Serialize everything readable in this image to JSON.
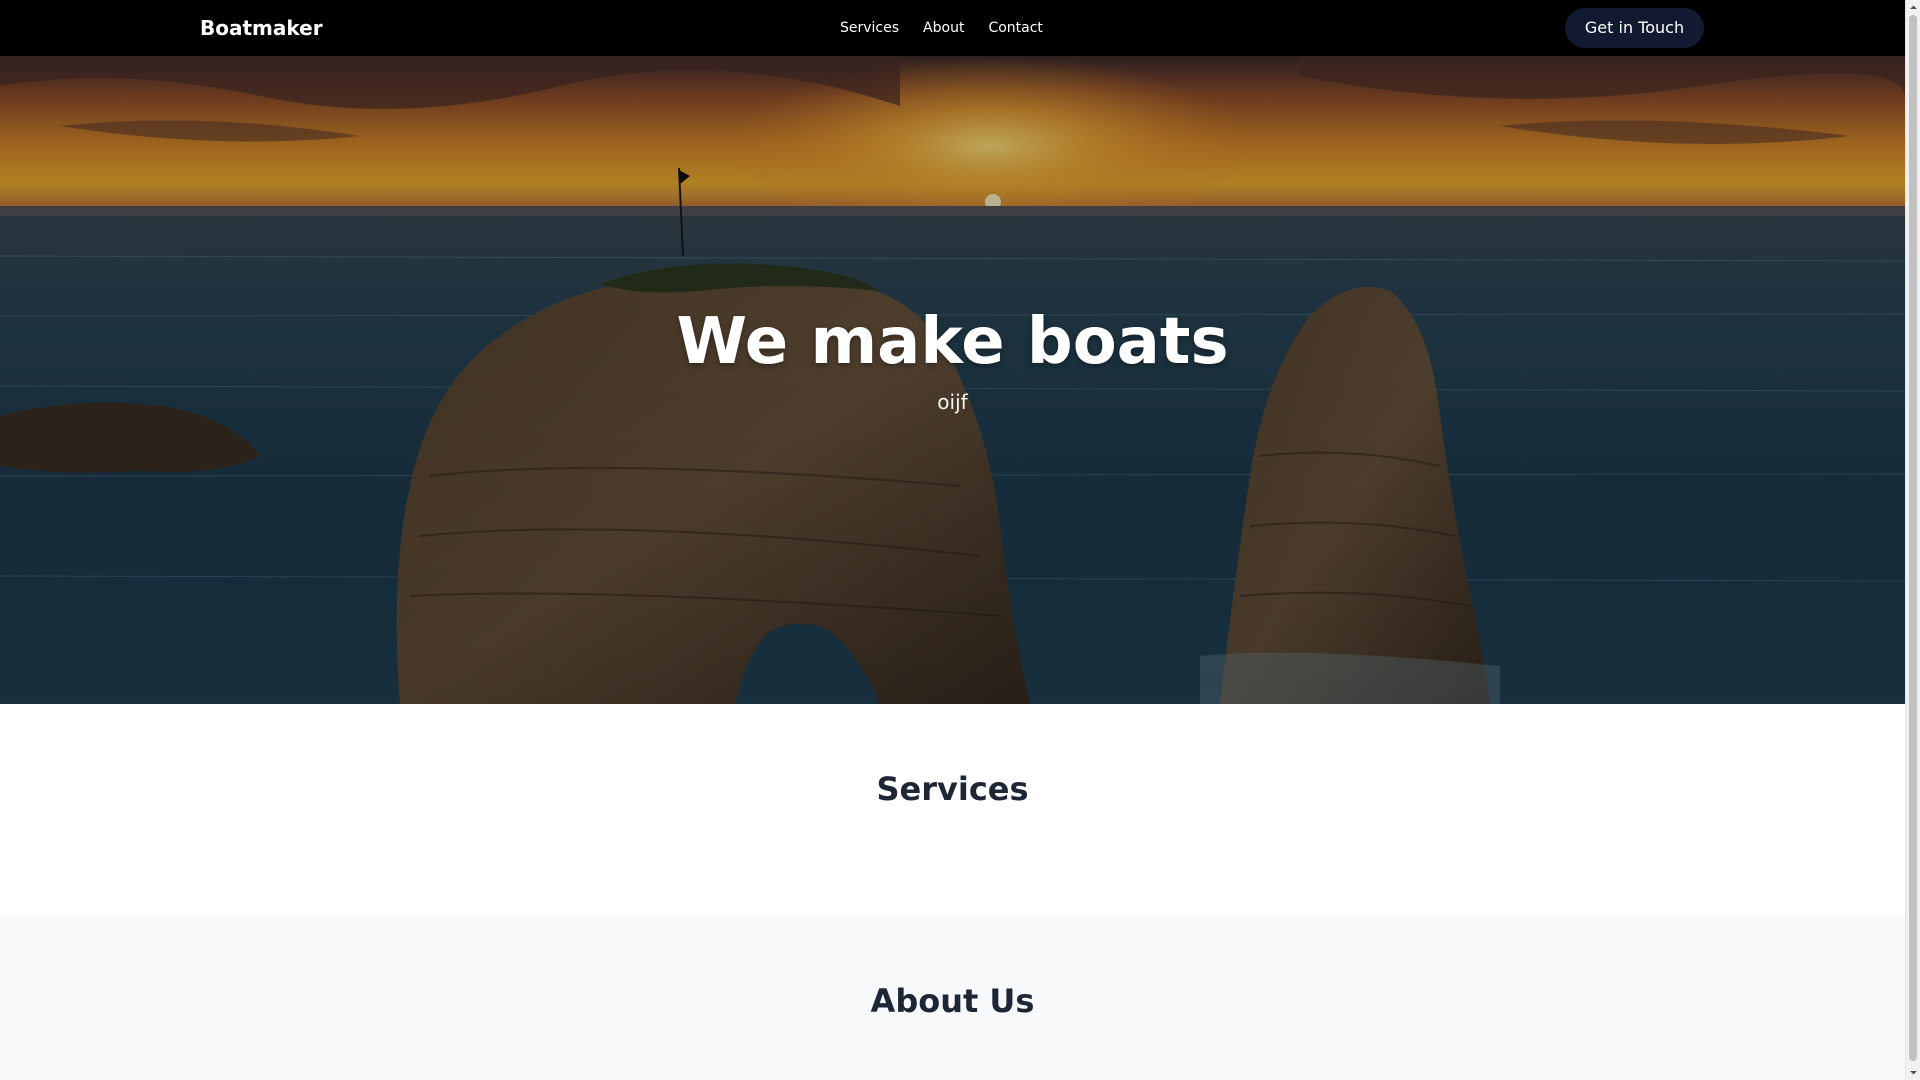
{
  "navbar": {
    "brand": "Boatmaker",
    "links": [
      {
        "label": "Services"
      },
      {
        "label": "About"
      },
      {
        "label": "Contact"
      }
    ],
    "cta_label": "Get in Touch",
    "background_color": "#000000",
    "cta_color": "#111a30"
  },
  "hero": {
    "title": "We make boats",
    "subtitle": "oijf",
    "background_image": "sunset-sea-rocks-photo"
  },
  "services": {
    "title": "Services"
  },
  "about": {
    "title": "About Us"
  },
  "colors": {
    "heading": "#1d2635",
    "about_background": "#f8f9fb"
  }
}
